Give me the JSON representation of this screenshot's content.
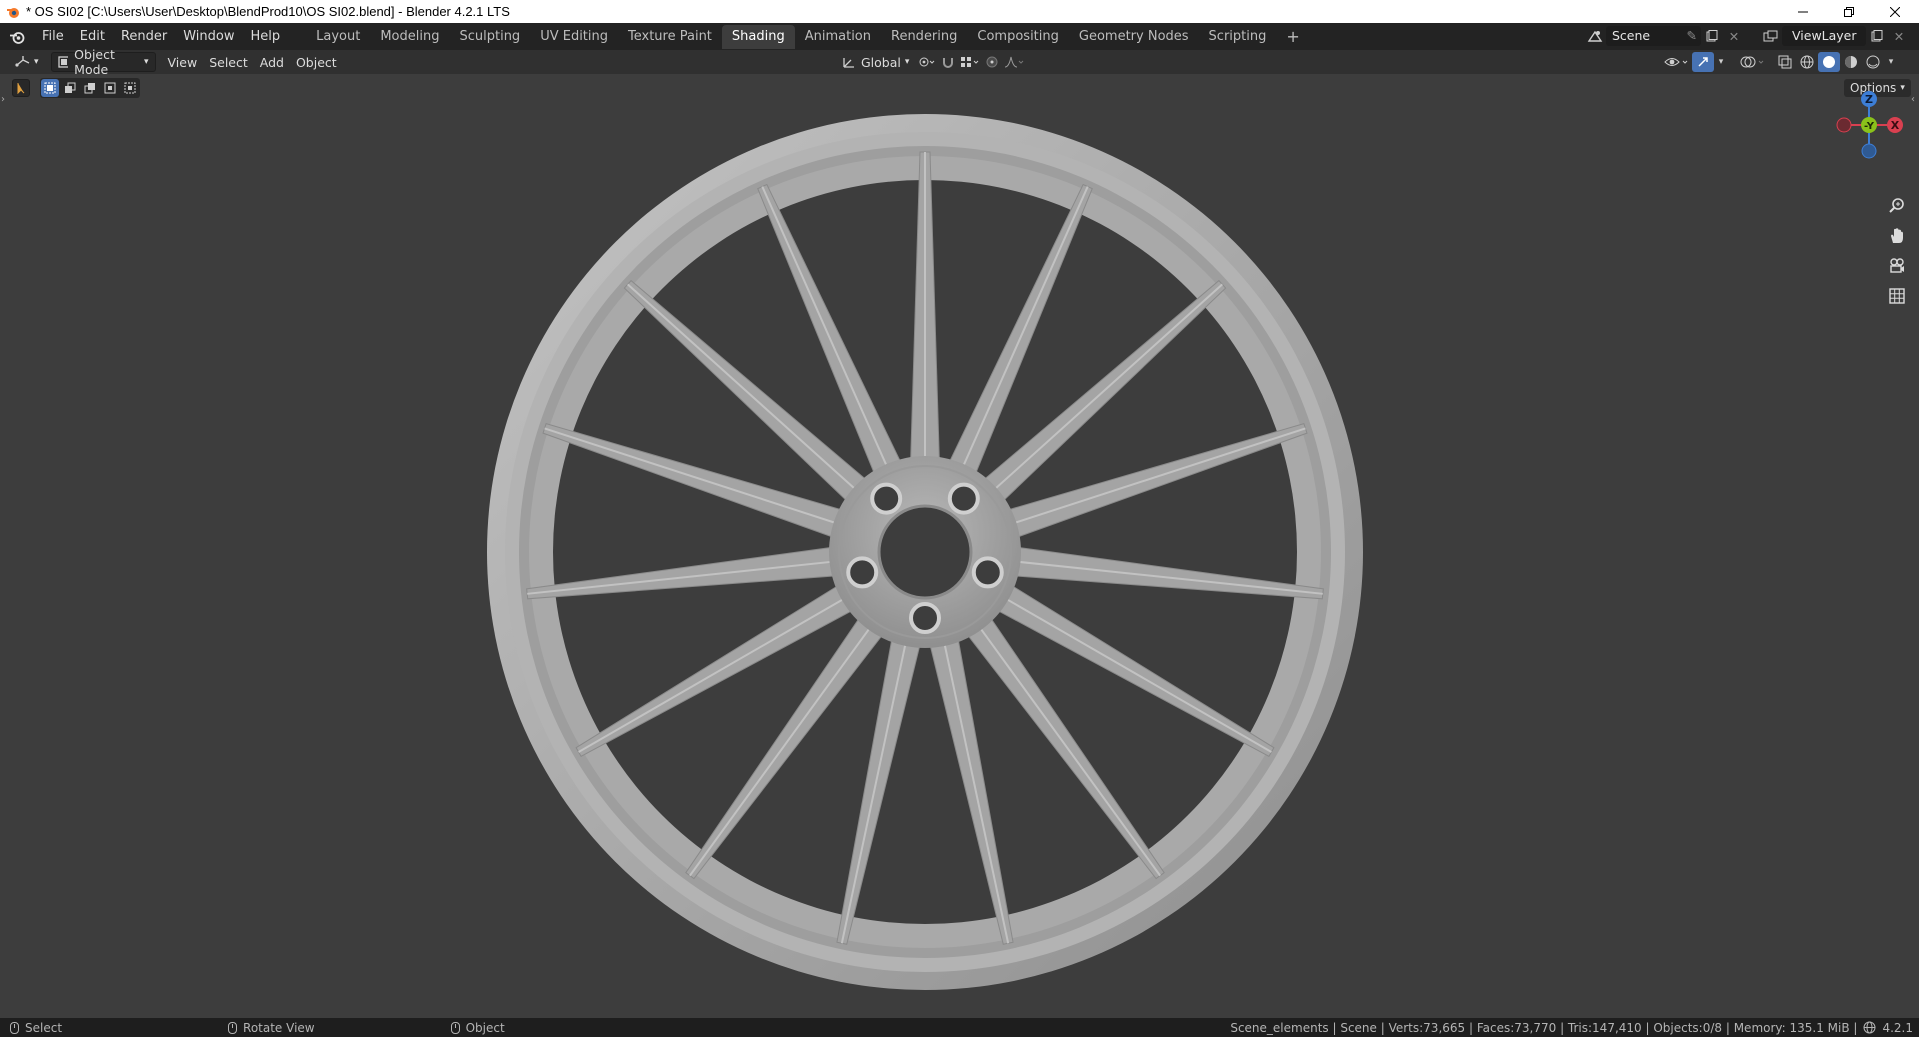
{
  "window": {
    "title": "* OS SI02 [C:\\Users\\User\\Desktop\\BlendProd10\\OS SI02.blend] - Blender 4.2.1 LTS"
  },
  "menu": [
    "File",
    "Edit",
    "Render",
    "Window",
    "Help"
  ],
  "workspaces": {
    "tabs": [
      "Layout",
      "Modeling",
      "Sculpting",
      "UV Editing",
      "Texture Paint",
      "Shading",
      "Animation",
      "Rendering",
      "Compositing",
      "Geometry Nodes",
      "Scripting"
    ],
    "active": "Shading"
  },
  "scene": {
    "name": "Scene"
  },
  "view_layer": {
    "name": "ViewLayer"
  },
  "header": {
    "mode": "Object Mode",
    "menus": [
      "View",
      "Select",
      "Add",
      "Object"
    ],
    "orientation": "Global",
    "options_label": "Options"
  },
  "gizmo": {
    "z": "Z",
    "y": "-Y",
    "x": "X"
  },
  "colors": {
    "axis_x": "#d94050",
    "axis_y": "#8ac21b",
    "axis_z": "#3d7ed6",
    "accent": "#4772b3",
    "wheel": "#a8a8a8"
  },
  "status": {
    "select": "Select",
    "rotate": "Rotate View",
    "object": "Object",
    "stats": "Scene_elements | Scene | Verts:73,665 | Faces:73,770 | Tris:147,410 | Objects:0/8 | Memory: 135.1 MiB |",
    "version": "4.2.1"
  }
}
